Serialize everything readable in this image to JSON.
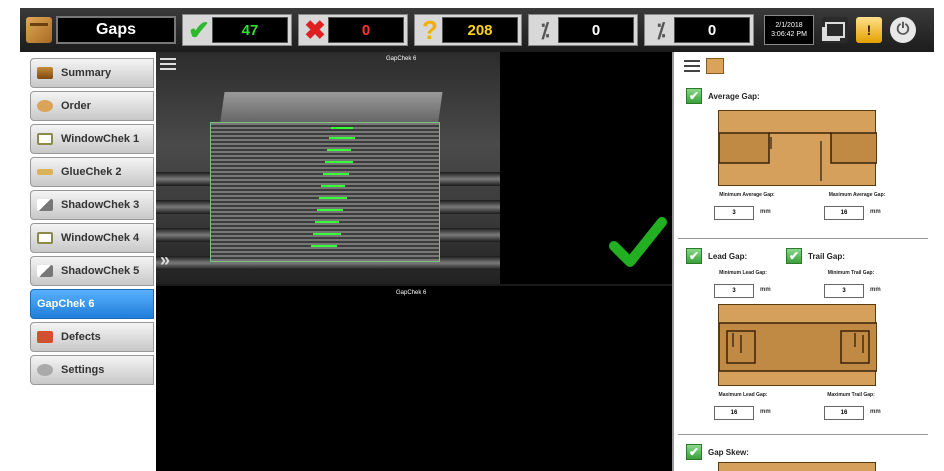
{
  "app": {
    "title": "Gaps",
    "counts": {
      "pass": "47",
      "fail": "0",
      "unknown": "208",
      "pct1": "0",
      "pct2": "0"
    },
    "clock": {
      "date": "2/1/2018",
      "time": "3:06:42 PM"
    },
    "icons": {
      "pass": "check-icon",
      "fail": "x-icon",
      "unknown": "question-icon",
      "pct1": "percent-icon",
      "pct2": "percent-hour-icon",
      "windows": "windows-icon",
      "warning": "warning-icon",
      "power": "power-icon"
    },
    "colors": {
      "pass": "#33dd33",
      "fail": "#ff3333",
      "unknown": "#ffd21a",
      "active_nav": "#1f7ed8"
    }
  },
  "sidebar": {
    "items": [
      {
        "label": "Summary",
        "icon": "summary-icon",
        "active": false
      },
      {
        "label": "Order",
        "icon": "order-icon",
        "active": false
      },
      {
        "label": "WindowChek 1",
        "icon": "window-icon",
        "active": false
      },
      {
        "label": "GlueChek 2",
        "icon": "glue-icon",
        "active": false
      },
      {
        "label": "ShadowChek 3",
        "icon": "shadow-icon",
        "active": false
      },
      {
        "label": "WindowChek 4",
        "icon": "window-icon",
        "active": false
      },
      {
        "label": "ShadowChek 5",
        "icon": "shadow-icon",
        "active": false
      },
      {
        "label": "GapChek 6",
        "icon": "",
        "active": true
      },
      {
        "label": "Defects",
        "icon": "defects-icon",
        "active": false
      },
      {
        "label": "Settings",
        "icon": "settings-icon",
        "active": false
      }
    ]
  },
  "camera": {
    "top_label": "GapChek 6",
    "bottom_label": "GapChek 6"
  },
  "panel": {
    "avg_gap": {
      "label": "Average Gap:",
      "min_label": "Minimum Average Gap:",
      "min_value": "3",
      "max_label": "Maximum Average Gap:",
      "max_value": "16",
      "unit": "mm"
    },
    "lead_gap": {
      "label": "Lead Gap:",
      "min_label": "Minimum Lead Gap:",
      "min_value": "3",
      "max_label": "Maximum Lead Gap:",
      "max_value": "16",
      "unit": "mm"
    },
    "trail_gap": {
      "label": "Trail Gap:",
      "min_label": "Minimum Trail Gap:",
      "min_value": "3",
      "max_label": "Maximum Trail Gap:",
      "max_value": "16",
      "unit": "mm"
    },
    "gap_skew": {
      "label": "Gap Skew:"
    }
  }
}
